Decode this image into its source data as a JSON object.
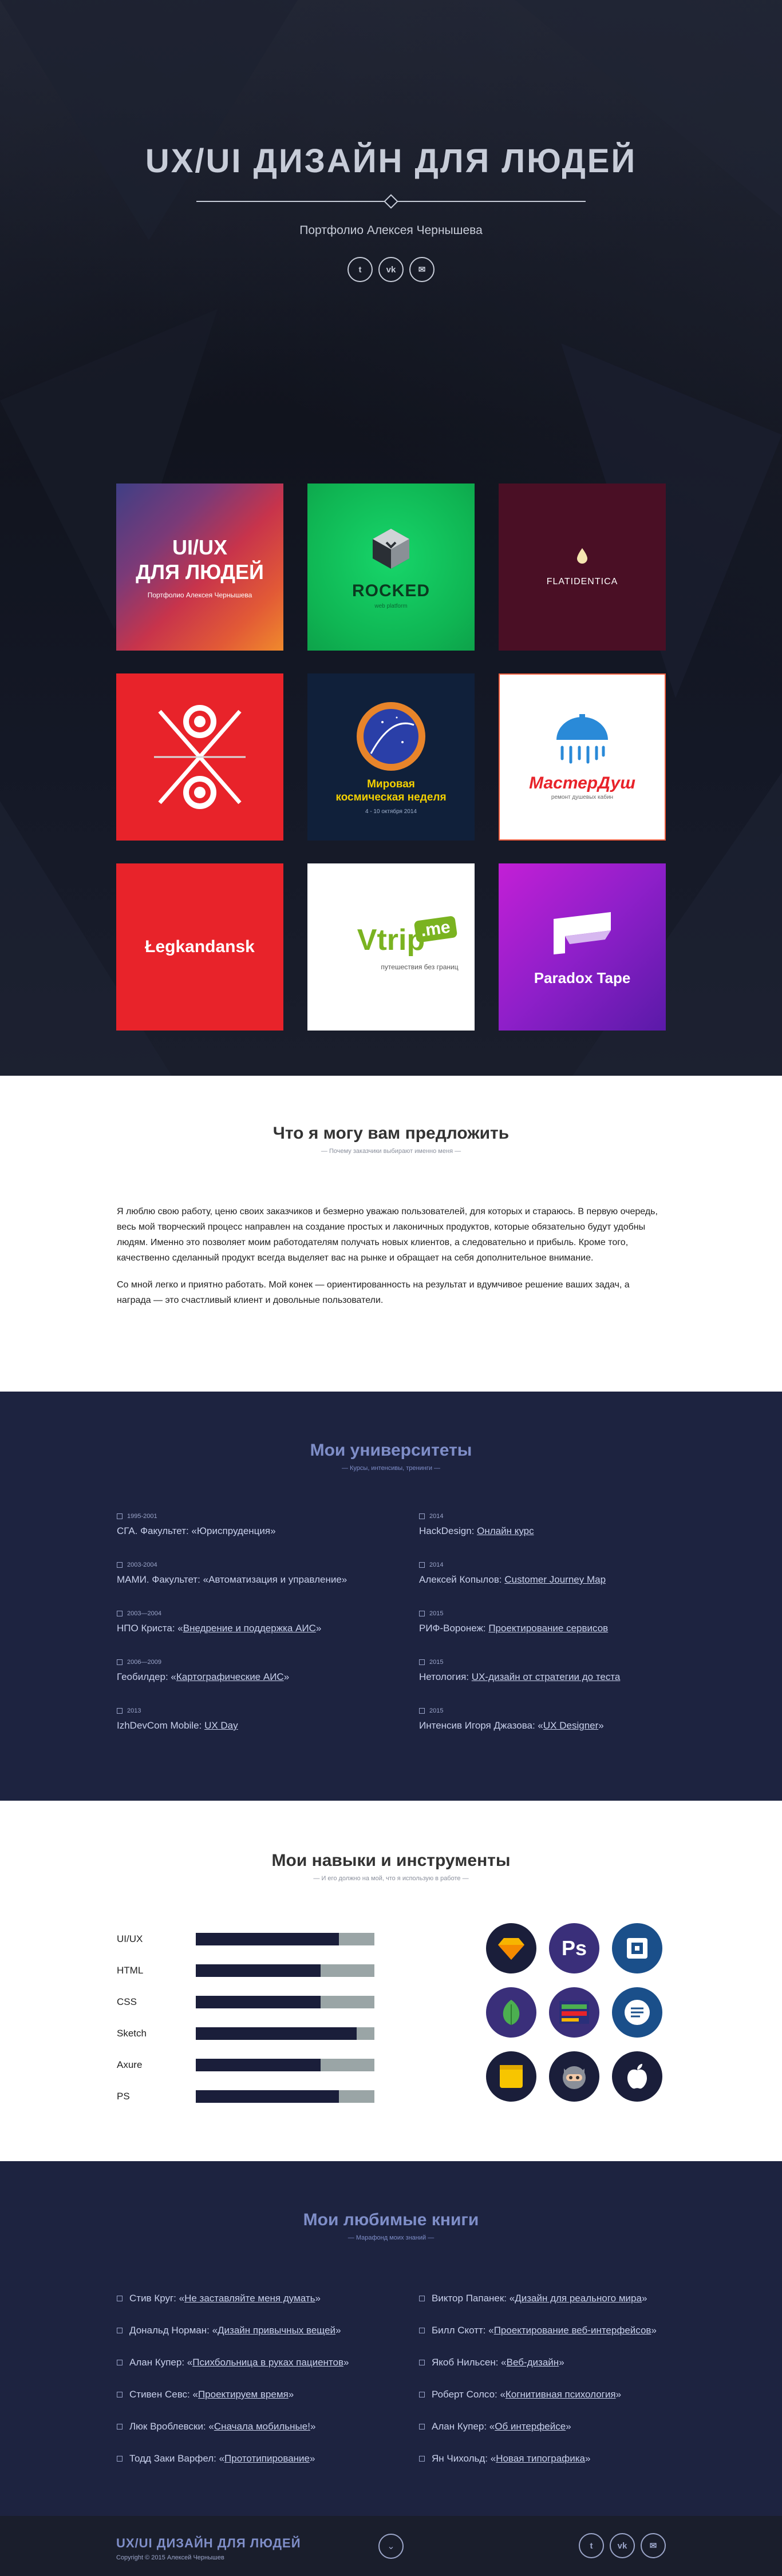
{
  "hero": {
    "title": "UX/UI ДИЗАЙН ДЛЯ ЛЮДЕЙ",
    "subtitle": "Портфолио Алексея Чернышева",
    "socials": [
      {
        "icon": "twitter-icon",
        "glyph": "t"
      },
      {
        "icon": "vk-icon",
        "glyph": "vk"
      },
      {
        "icon": "mail-icon",
        "glyph": "✉"
      }
    ]
  },
  "portfolio": [
    {
      "big": "UI/UX\nДЛЯ ЛЮДЕЙ",
      "small": "Портфолио Алексея Чернышева"
    },
    {
      "name": "ROCKED",
      "tag": "web platform"
    },
    {
      "name": "FLATIDENTICA"
    },
    {
      "name": ""
    },
    {
      "name": "Мировая\nкосмическая неделя",
      "date": "4 - 10 октября 2014"
    },
    {
      "name": "МастерДуш",
      "tag": "ремонт душевых кабин"
    },
    {
      "name": "Łegkandansk"
    },
    {
      "logo_a": "Vtrip",
      "logo_b": ".me",
      "tag": "путешествия без границ"
    },
    {
      "name": "Paradox Tape"
    }
  ],
  "offer": {
    "title": "Что я могу вам предложить",
    "subtitle": "— Почему заказчики выбирают именно меня —",
    "p1": "Я люблю свою работу, ценю своих заказчиков и безмерно уважаю пользователей, для которых и стараюсь. В первую очередь, весь мой творческий процесс направлен на создание простых и лаконичных продуктов, которые обязательно будут удобны людям. Именно это позволяет моим работодателям получать новых клиентов, а следовательно и прибыль. Кроме того, качественно сделанный продукт всегда выделяет вас на рынке и обращает на себя дополнительное внимание.",
    "p2": "Со мной легко и приятно работать. Мой конек — ориентированность на результат и вдумчивое решение ваших задач, а награда — это счастливый клиент и довольные пользователи."
  },
  "universities": {
    "title": "Мои университеты",
    "subtitle": "— Курсы, интенсивы, тренинги —",
    "left": [
      {
        "date": "1995-2001",
        "text": "СГА. Факультет: «Юриспруденция»",
        "link": ""
      },
      {
        "date": "2003-2004",
        "text": "МАМИ. Факультет: «Автоматизация и управление»",
        "link": ""
      },
      {
        "date": "2003—2004",
        "text": "НПО Криста: «",
        "link": "Внедрение и поддержка АИС",
        "after": "»"
      },
      {
        "date": "2006—2009",
        "text": "Геобилдер: «",
        "link": "Картографические АИС",
        "after": "»"
      },
      {
        "date": "2013",
        "text": "IzhDevCom Mobile: ",
        "link": "UX Day",
        "after": ""
      }
    ],
    "right": [
      {
        "date": "2014",
        "text": "HackDesign: ",
        "link": "Онлайн курс",
        "after": ""
      },
      {
        "date": "2014",
        "text": "Алексей Копылов: ",
        "link": "Customer Journey Map",
        "after": ""
      },
      {
        "date": "2015",
        "text": "РИФ-Воронеж: ",
        "link": "Проектирование сервисов",
        "after": ""
      },
      {
        "date": "2015",
        "text": "Нетология: ",
        "link": "UX-дизайн от стратегии до теста",
        "after": ""
      },
      {
        "date": "2015",
        "text": "Интенсив Игоря Джазова: «",
        "link": "UX Designer",
        "after": "»"
      }
    ]
  },
  "skills": {
    "title": "Мои навыки и инструменты",
    "subtitle": "— И его должно на мой, что я использую в работе —",
    "bars": [
      {
        "label": "UI/UX",
        "level": 0.8
      },
      {
        "label": "HTML",
        "level": 0.7
      },
      {
        "label": "CSS",
        "level": 0.7
      },
      {
        "label": "Sketch",
        "level": 0.9
      },
      {
        "label": "Axure",
        "level": 0.7
      },
      {
        "label": "PS",
        "level": 0.8
      }
    ],
    "tools": [
      {
        "icon": "sketch-icon",
        "bg": "#1a1e3a"
      },
      {
        "icon": "photoshop-icon",
        "bg": "#3a2f7a"
      },
      {
        "icon": "framer-icon",
        "bg": "#1a4f8a"
      },
      {
        "icon": "leaf-icon",
        "bg": "#3a2f7a"
      },
      {
        "icon": "balsamiq-icon",
        "bg": "#3a2f7a"
      },
      {
        "icon": "notes-icon",
        "bg": "#1a4f8a"
      },
      {
        "icon": "stickies-icon",
        "bg": "#1a1e3a"
      },
      {
        "icon": "github-icon",
        "bg": "#1a1e3a"
      },
      {
        "icon": "apple-icon",
        "bg": "#1a1e3a"
      }
    ]
  },
  "books": {
    "title": "Мои любимые книги",
    "subtitle": "— Марафонд моих знаний —",
    "left": [
      {
        "text": "Стив Круг: «",
        "link": "Не заставляйте меня думать",
        "after": "»"
      },
      {
        "text": "Дональд Норман: «",
        "link": "Дизайн привычных вещей",
        "after": "»"
      },
      {
        "text": "Алан Купер: «",
        "link": "Психбольница в руках пациентов",
        "after": "»"
      },
      {
        "text": "Стивен Севс: «",
        "link": "Проектируем время",
        "after": "»"
      },
      {
        "text": "Люк Вроблевски: «",
        "link": "Сначала мобильные!",
        "after": "»"
      },
      {
        "text": "Тодд Заки Варфел: «",
        "link": "Прототипирование",
        "after": "»"
      }
    ],
    "right": [
      {
        "text": "Виктор Папанек: «",
        "link": "Дизайн для реального мира",
        "after": "»"
      },
      {
        "text": "Билл Скотт: «",
        "link": "Проектирование веб-интерфейсов",
        "after": "»"
      },
      {
        "text": "Якоб Нильсен: «",
        "link": "Веб-дизайн",
        "after": "»"
      },
      {
        "text": "Роберт Солсо: «",
        "link": "Когнитивная психология",
        "after": "»"
      },
      {
        "text": "Алан Купер: «",
        "link": "Об интерфейсе",
        "after": "»"
      },
      {
        "text": "Ян Чихольд: «",
        "link": "Новая типографика",
        "after": "»"
      }
    ]
  },
  "footer": {
    "title": "UX/UI ДИЗАЙН ДЛЯ ЛЮДЕЙ",
    "copyright": "Copyright © 2015 Алексей Чернышев",
    "up": "⌄",
    "socials": [
      {
        "icon": "twitter-icon",
        "glyph": "t"
      },
      {
        "icon": "vk-icon",
        "glyph": "vk"
      },
      {
        "icon": "mail-icon",
        "glyph": "✉"
      }
    ]
  }
}
